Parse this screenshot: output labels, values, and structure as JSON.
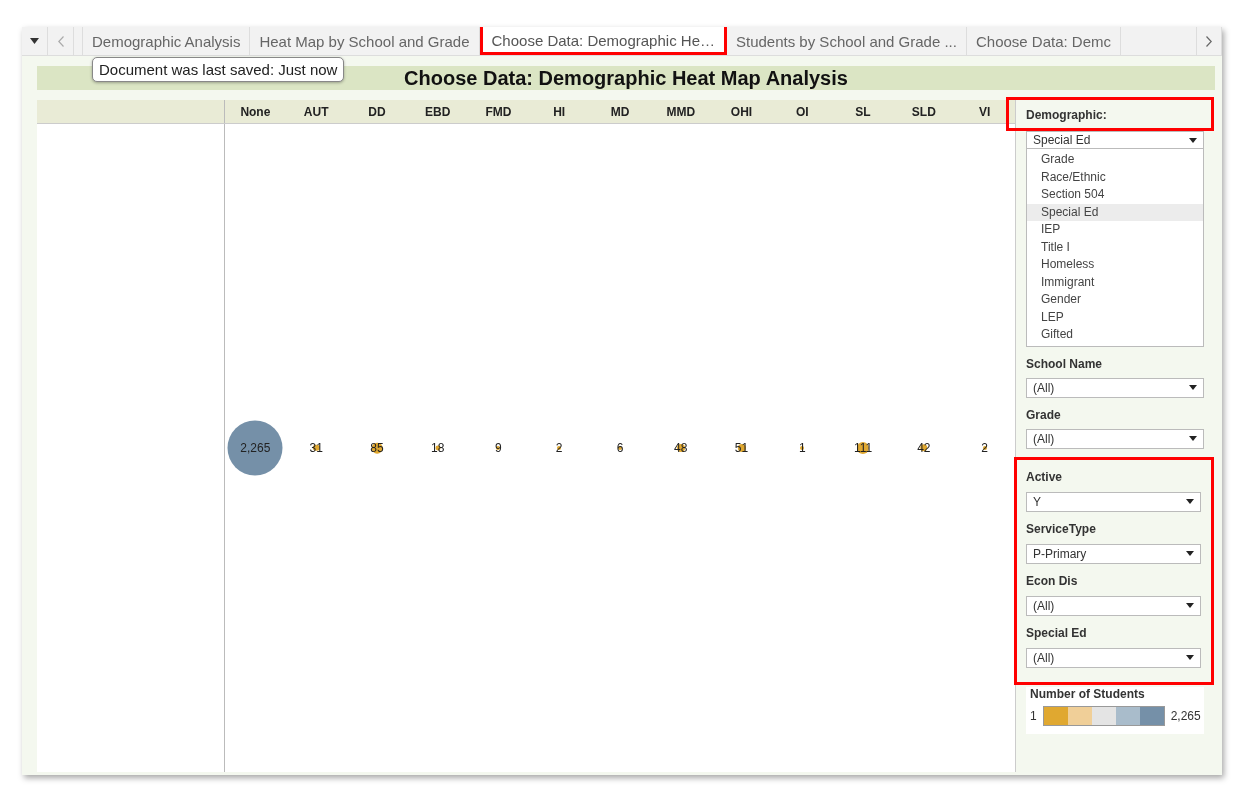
{
  "tabs": [
    {
      "label": "Demographic Analysis",
      "selected": false,
      "highlighted": false
    },
    {
      "label": "Heat Map by School and Grade",
      "selected": false,
      "highlighted": false
    },
    {
      "label": "Choose Data: Demographic He…",
      "selected": true,
      "highlighted": true
    },
    {
      "label": "Students by School and Grade ...",
      "selected": false,
      "highlighted": false
    },
    {
      "label": "Choose Data: Demc",
      "selected": false,
      "highlighted": false
    }
  ],
  "tooltip": "Document was last saved: Just now",
  "title": "Choose Data: Demographic Heat Map Analysis",
  "heatmap": {
    "columns": [
      "None",
      "AUT",
      "DD",
      "EBD",
      "FMD",
      "HI",
      "MD",
      "MMD",
      "OHI",
      "OI",
      "SL",
      "SLD",
      "VI"
    ],
    "cells": [
      {
        "value": "2,265",
        "color": "#7590a8"
      },
      {
        "value": "31",
        "color": "#e0a830"
      },
      {
        "value": "85",
        "color": "#e0a830"
      },
      {
        "value": "18",
        "color": "#e0a830"
      },
      {
        "value": "9",
        "color": "#e0a830"
      },
      {
        "value": "2",
        "color": "#e0a830"
      },
      {
        "value": "6",
        "color": "#e0a830"
      },
      {
        "value": "48",
        "color": "#e0a830"
      },
      {
        "value": "51",
        "color": "#e0a830"
      },
      {
        "value": "1",
        "color": "#e0a830"
      },
      {
        "value": "111",
        "color": "#e0a830"
      },
      {
        "value": "42",
        "color": "#e0a830"
      },
      {
        "value": "2",
        "color": "#e0a830"
      }
    ]
  },
  "demographic": {
    "label": "Demographic:",
    "highlighted": true,
    "value": "Special Ed",
    "options": [
      {
        "label": "Grade",
        "selected": false
      },
      {
        "label": "Race/Ethnic",
        "selected": false
      },
      {
        "label": "Section 504",
        "selected": false
      },
      {
        "label": "Special Ed",
        "selected": true
      },
      {
        "label": "IEP",
        "selected": false
      },
      {
        "label": "Title I",
        "selected": false
      },
      {
        "label": "Homeless",
        "selected": false
      },
      {
        "label": "Immigrant",
        "selected": false
      },
      {
        "label": "Gender",
        "selected": false
      },
      {
        "label": "LEP",
        "selected": false
      },
      {
        "label": "Gifted",
        "selected": false
      }
    ]
  },
  "filter_groups": [
    {
      "highlighted": false,
      "filters": [
        {
          "label": "School Name",
          "value": "(All)"
        },
        {
          "label": "Grade",
          "value": "(All)"
        }
      ]
    },
    {
      "highlighted": true,
      "filters": [
        {
          "label": "Active",
          "value": "Y"
        },
        {
          "label": "ServiceType",
          "value": "P-Primary"
        },
        {
          "label": "Econ Dis",
          "value": "(All)"
        },
        {
          "label": "Special Ed",
          "value": "(All)"
        }
      ]
    }
  ],
  "legend": {
    "title": "Number of Students",
    "min": "1",
    "max": "2,265",
    "swatches": [
      {
        "color": "#e0a830"
      },
      {
        "color": "#f0cf98"
      },
      {
        "color": "#e4e4e4"
      },
      {
        "color": "#a9bccb"
      },
      {
        "color": "#7590a8"
      }
    ]
  }
}
